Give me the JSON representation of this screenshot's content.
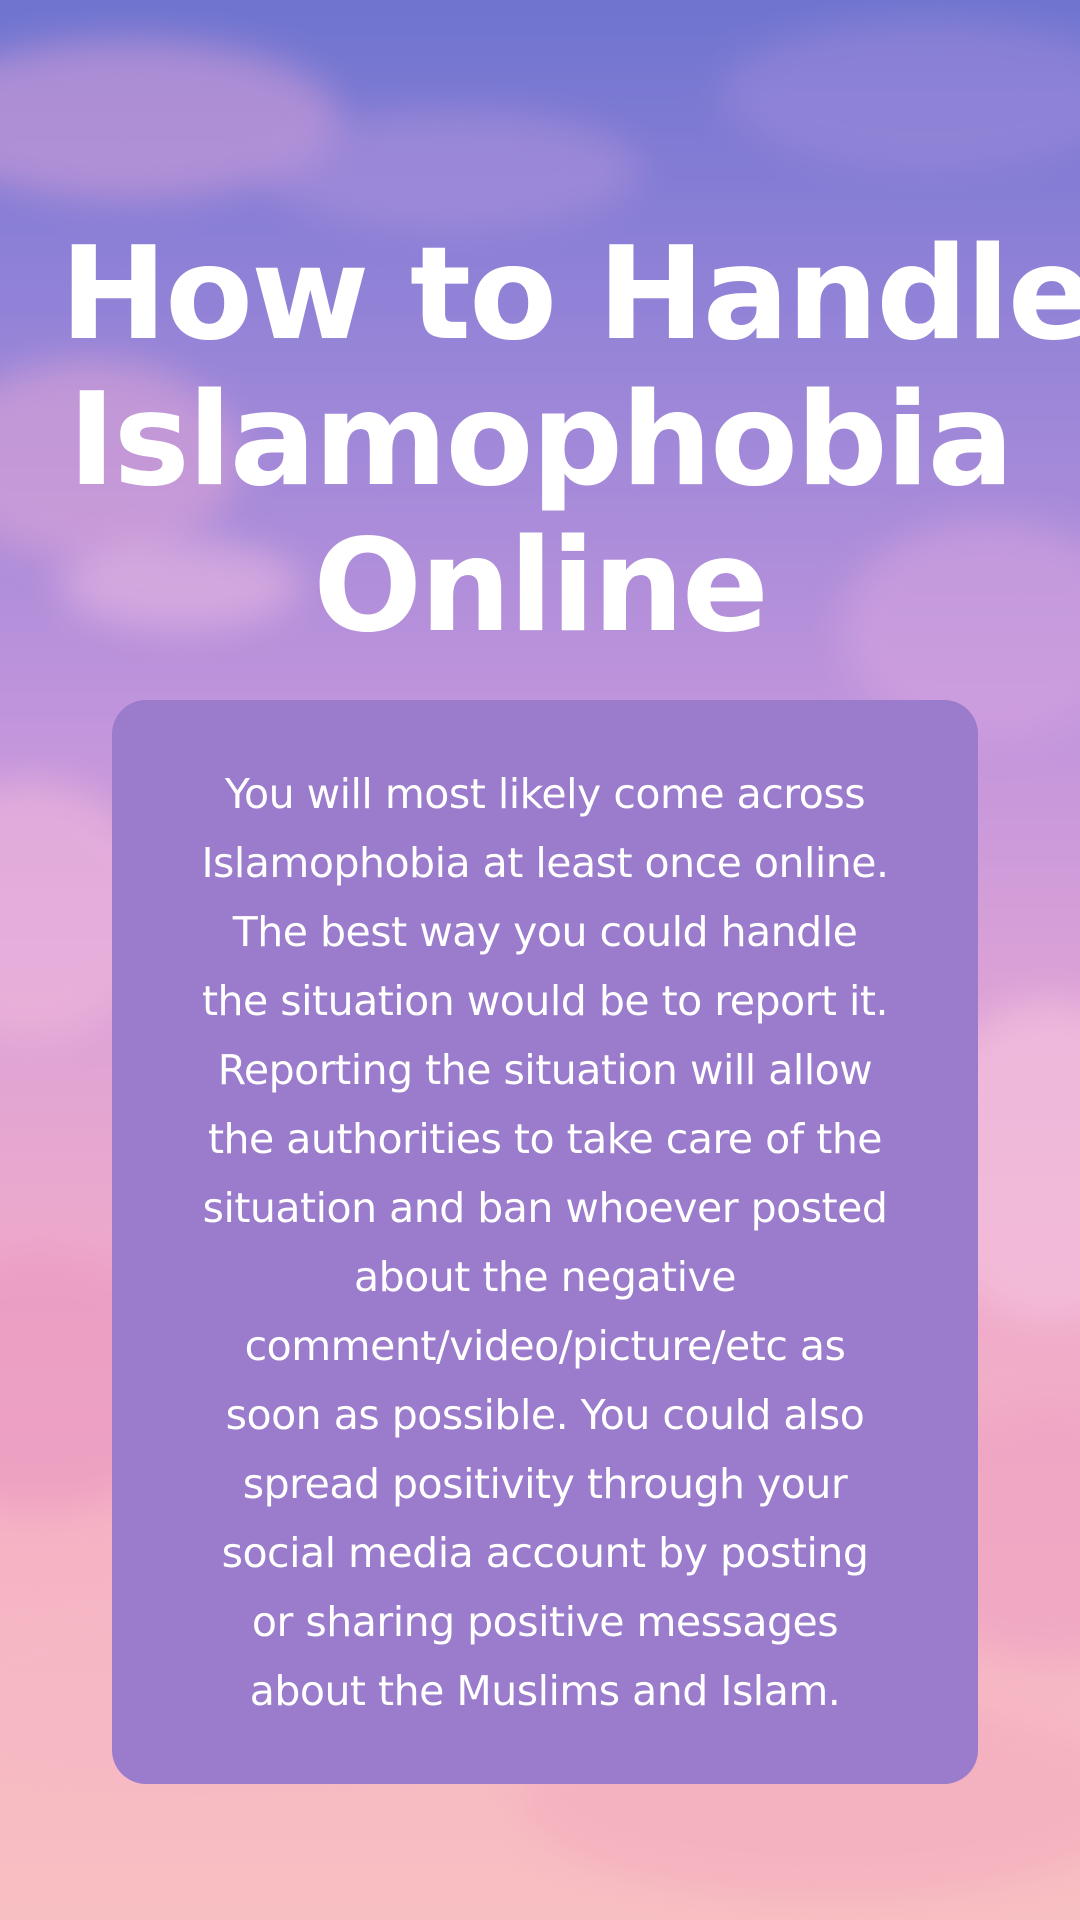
{
  "title": {
    "lines": [
      "How to Handle",
      "Islamophobia",
      "Online"
    ]
  },
  "body": {
    "lines": [
      "You will most likely come across",
      "Islamophobia at least once online.",
      "The best way you could handle",
      "the situation would be to report it.",
      "Reporting the situation will allow",
      "the authorities to take care of the",
      "situation and ban whoever posted",
      "about the negative",
      "comment/video/picture/etc as",
      "soon as possible. You could also",
      "spread positivity through your",
      "social media account by posting",
      "or sharing positive messages",
      "about the Muslims and Islam."
    ]
  },
  "colors": {
    "card_background": "#9b7bcb",
    "text": "#ffffff",
    "sky_top": "#6f74cf",
    "sky_bottom": "#f8bfc2"
  }
}
